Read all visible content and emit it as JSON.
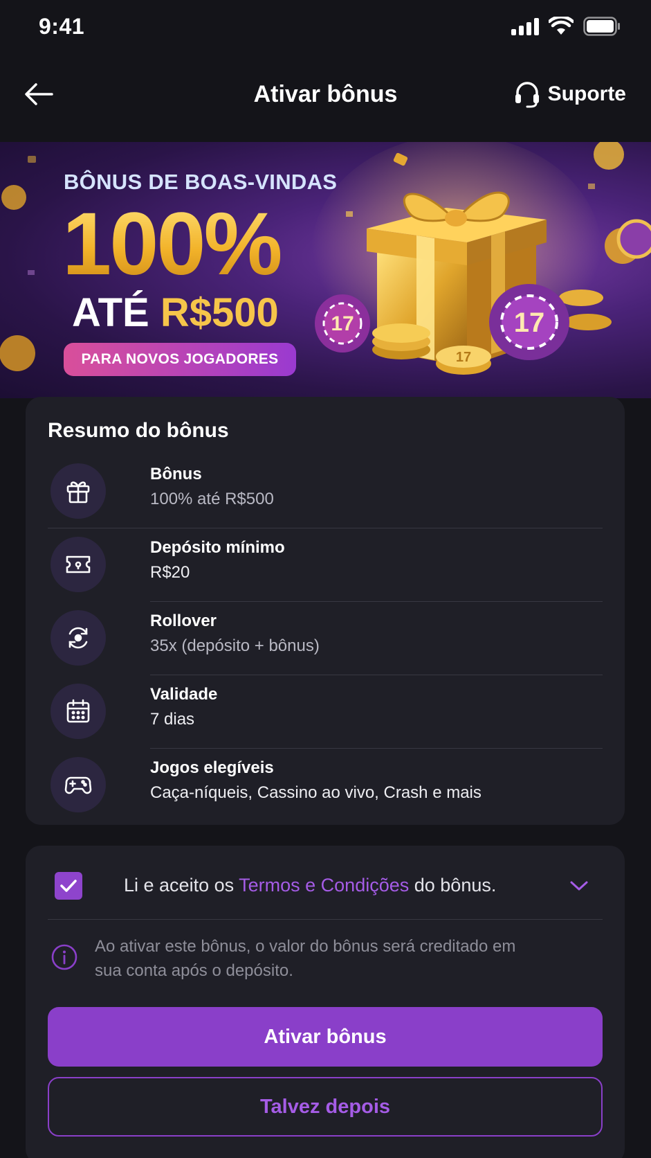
{
  "status_bar": {
    "time": "9:41"
  },
  "header": {
    "title": "Ativar bônus",
    "support_label": "Suporte"
  },
  "banner": {
    "kicker": "BÔNUS DE BOAS-VINDAS",
    "headline": "100%",
    "upto_prefix": "ATÉ",
    "upto_amount": "R$500",
    "pill": "PARA NOVOS JOGADORES",
    "chip_number": "17"
  },
  "summary": {
    "title": "Resumo do bônus",
    "rows": [
      {
        "icon": "gift-icon",
        "label": "Bônus",
        "value": "100% até R$500"
      },
      {
        "icon": "deposit-ticket-icon",
        "label": "Depósito mínimo",
        "value": "R$20"
      },
      {
        "icon": "rollover-icon",
        "label": "Rollover",
        "value": "35x (depósito + bônus)"
      },
      {
        "icon": "calendar-icon",
        "label": "Validade",
        "value": "7 dias"
      },
      {
        "icon": "gamepad-icon",
        "label": "Jogos elegíveis",
        "value": "Caça-níqueis, Cassino ao vivo, Crash e mais"
      }
    ]
  },
  "terms": {
    "checked": true,
    "prefix": "Li e aceito os ",
    "link": "Termos e Condições",
    "suffix": " do bônus.",
    "info": "Ao ativar este bônus, o valor do bônus será creditado em sua conta após o depósito."
  },
  "actions": {
    "primary": "Ativar bônus",
    "secondary": "Talvez depois"
  },
  "colors": {
    "accent": "#8a3fc9",
    "link": "#a55ce6",
    "gold": "#f2b32a",
    "card": "#1f1f27",
    "background": "#141419"
  }
}
